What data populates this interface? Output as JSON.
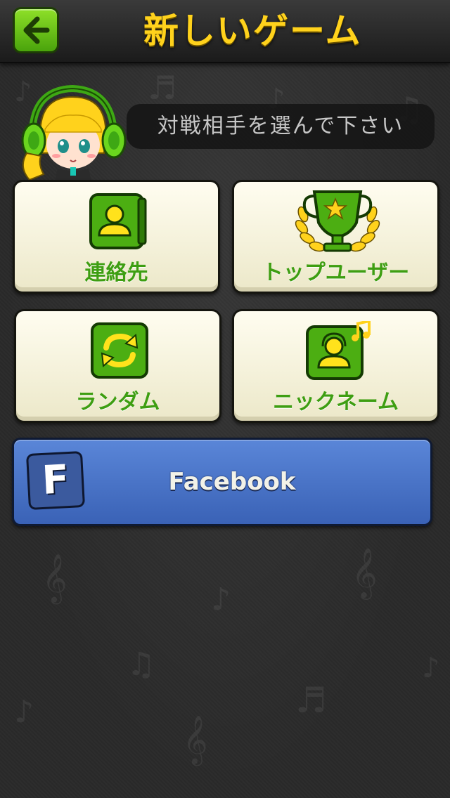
{
  "header": {
    "title": "新しいゲーム",
    "back_icon": "arrow-left-icon"
  },
  "prompt": {
    "text": "対戦相手を選んで下さい"
  },
  "options": [
    {
      "label": "連絡先",
      "icon": "contacts-book-icon"
    },
    {
      "label": "トップユーザー",
      "icon": "trophy-icon"
    },
    {
      "label": "ランダム",
      "icon": "shuffle-icon"
    },
    {
      "label": "ニックネーム",
      "icon": "user-music-icon"
    }
  ],
  "facebook": {
    "label": "Facebook",
    "logo_letter": "F",
    "icon": "facebook-icon"
  },
  "colors": {
    "title": "#ffd21c",
    "accent_green": "#3e9e12",
    "facebook_blue": "#4a74c8",
    "card_bg": "#f7f4df"
  }
}
